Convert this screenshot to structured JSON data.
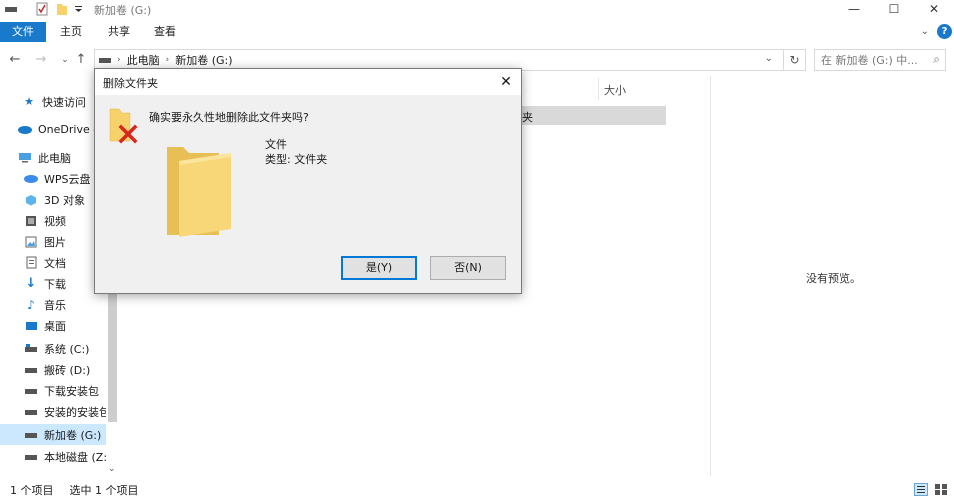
{
  "window": {
    "title": "新加卷 (G:)",
    "minimize_glyph": "—",
    "maximize_glyph": "☐",
    "close_glyph": "✕"
  },
  "ribbon": {
    "tabs": [
      "文件",
      "主页",
      "共享",
      "查看"
    ],
    "help_glyph": "?"
  },
  "nav": {
    "breadcrumb": [
      "此电脑",
      "新加卷 (G:)"
    ],
    "search_placeholder": "在 新加卷 (G:) 中..."
  },
  "sidebar": {
    "items": [
      {
        "label": "快速访问",
        "icon": "star-icon"
      },
      {
        "label": "OneDrive -",
        "icon": "cloud-icon"
      },
      {
        "label": "此电脑",
        "icon": "computer-icon"
      },
      {
        "label": "WPS云盘",
        "icon": "wps-cloud-icon"
      },
      {
        "label": "3D 对象",
        "icon": "cube-icon"
      },
      {
        "label": "视频",
        "icon": "video-icon"
      },
      {
        "label": "图片",
        "icon": "picture-icon"
      },
      {
        "label": "文档",
        "icon": "document-icon"
      },
      {
        "label": "下载",
        "icon": "download-icon"
      },
      {
        "label": "音乐",
        "icon": "music-icon"
      },
      {
        "label": "桌面",
        "icon": "desktop-icon"
      },
      {
        "label": "系统 (C:)",
        "icon": "drive-icon"
      },
      {
        "label": "搬砖 (D:)",
        "icon": "drive-icon"
      },
      {
        "label": "下载安装包",
        "icon": "drive-icon"
      },
      {
        "label": "安装的安装包",
        "icon": "drive-icon"
      },
      {
        "label": "新加卷 (G:)",
        "icon": "drive-icon"
      },
      {
        "label": "本地磁盘 (Z:",
        "icon": "drive-icon"
      }
    ]
  },
  "filelist": {
    "col_size": "大小",
    "row_fragment": "夹"
  },
  "preview": {
    "empty_text": "没有预览。"
  },
  "status": {
    "count": "1 个项目",
    "selected": "选中 1 个项目"
  },
  "dialog": {
    "title": "删除文件夹",
    "question": "确实要永久性地删除此文件夹吗?",
    "item_name": "文件",
    "item_type": "类型: 文件夹",
    "yes_label": "是(Y)",
    "no_label": "否(N)"
  },
  "colors": {
    "accent": "#1979ca",
    "selection": "#cce8ff",
    "folder": "#f7d26a",
    "delete_x": "#d9261c"
  }
}
